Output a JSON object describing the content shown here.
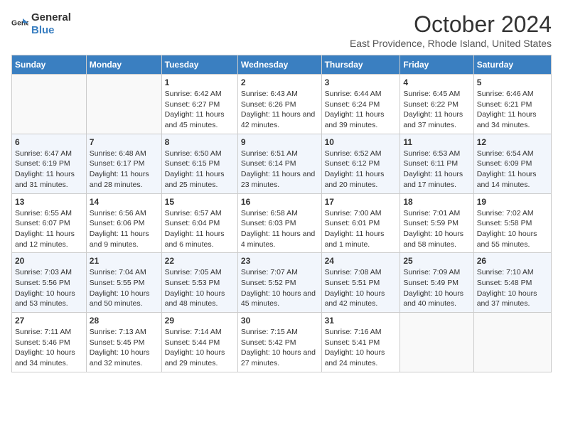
{
  "header": {
    "logo_general": "General",
    "logo_blue": "Blue",
    "title": "October 2024",
    "subtitle": "East Providence, Rhode Island, United States"
  },
  "days_of_week": [
    "Sunday",
    "Monday",
    "Tuesday",
    "Wednesday",
    "Thursday",
    "Friday",
    "Saturday"
  ],
  "weeks": [
    [
      {
        "day": "",
        "info": ""
      },
      {
        "day": "",
        "info": ""
      },
      {
        "day": "1",
        "info": "Sunrise: 6:42 AM\nSunset: 6:27 PM\nDaylight: 11 hours and 45 minutes."
      },
      {
        "day": "2",
        "info": "Sunrise: 6:43 AM\nSunset: 6:26 PM\nDaylight: 11 hours and 42 minutes."
      },
      {
        "day": "3",
        "info": "Sunrise: 6:44 AM\nSunset: 6:24 PM\nDaylight: 11 hours and 39 minutes."
      },
      {
        "day": "4",
        "info": "Sunrise: 6:45 AM\nSunset: 6:22 PM\nDaylight: 11 hours and 37 minutes."
      },
      {
        "day": "5",
        "info": "Sunrise: 6:46 AM\nSunset: 6:21 PM\nDaylight: 11 hours and 34 minutes."
      }
    ],
    [
      {
        "day": "6",
        "info": "Sunrise: 6:47 AM\nSunset: 6:19 PM\nDaylight: 11 hours and 31 minutes."
      },
      {
        "day": "7",
        "info": "Sunrise: 6:48 AM\nSunset: 6:17 PM\nDaylight: 11 hours and 28 minutes."
      },
      {
        "day": "8",
        "info": "Sunrise: 6:50 AM\nSunset: 6:15 PM\nDaylight: 11 hours and 25 minutes."
      },
      {
        "day": "9",
        "info": "Sunrise: 6:51 AM\nSunset: 6:14 PM\nDaylight: 11 hours and 23 minutes."
      },
      {
        "day": "10",
        "info": "Sunrise: 6:52 AM\nSunset: 6:12 PM\nDaylight: 11 hours and 20 minutes."
      },
      {
        "day": "11",
        "info": "Sunrise: 6:53 AM\nSunset: 6:11 PM\nDaylight: 11 hours and 17 minutes."
      },
      {
        "day": "12",
        "info": "Sunrise: 6:54 AM\nSunset: 6:09 PM\nDaylight: 11 hours and 14 minutes."
      }
    ],
    [
      {
        "day": "13",
        "info": "Sunrise: 6:55 AM\nSunset: 6:07 PM\nDaylight: 11 hours and 12 minutes."
      },
      {
        "day": "14",
        "info": "Sunrise: 6:56 AM\nSunset: 6:06 PM\nDaylight: 11 hours and 9 minutes."
      },
      {
        "day": "15",
        "info": "Sunrise: 6:57 AM\nSunset: 6:04 PM\nDaylight: 11 hours and 6 minutes."
      },
      {
        "day": "16",
        "info": "Sunrise: 6:58 AM\nSunset: 6:03 PM\nDaylight: 11 hours and 4 minutes."
      },
      {
        "day": "17",
        "info": "Sunrise: 7:00 AM\nSunset: 6:01 PM\nDaylight: 11 hours and 1 minute."
      },
      {
        "day": "18",
        "info": "Sunrise: 7:01 AM\nSunset: 5:59 PM\nDaylight: 10 hours and 58 minutes."
      },
      {
        "day": "19",
        "info": "Sunrise: 7:02 AM\nSunset: 5:58 PM\nDaylight: 10 hours and 55 minutes."
      }
    ],
    [
      {
        "day": "20",
        "info": "Sunrise: 7:03 AM\nSunset: 5:56 PM\nDaylight: 10 hours and 53 minutes."
      },
      {
        "day": "21",
        "info": "Sunrise: 7:04 AM\nSunset: 5:55 PM\nDaylight: 10 hours and 50 minutes."
      },
      {
        "day": "22",
        "info": "Sunrise: 7:05 AM\nSunset: 5:53 PM\nDaylight: 10 hours and 48 minutes."
      },
      {
        "day": "23",
        "info": "Sunrise: 7:07 AM\nSunset: 5:52 PM\nDaylight: 10 hours and 45 minutes."
      },
      {
        "day": "24",
        "info": "Sunrise: 7:08 AM\nSunset: 5:51 PM\nDaylight: 10 hours and 42 minutes."
      },
      {
        "day": "25",
        "info": "Sunrise: 7:09 AM\nSunset: 5:49 PM\nDaylight: 10 hours and 40 minutes."
      },
      {
        "day": "26",
        "info": "Sunrise: 7:10 AM\nSunset: 5:48 PM\nDaylight: 10 hours and 37 minutes."
      }
    ],
    [
      {
        "day": "27",
        "info": "Sunrise: 7:11 AM\nSunset: 5:46 PM\nDaylight: 10 hours and 34 minutes."
      },
      {
        "day": "28",
        "info": "Sunrise: 7:13 AM\nSunset: 5:45 PM\nDaylight: 10 hours and 32 minutes."
      },
      {
        "day": "29",
        "info": "Sunrise: 7:14 AM\nSunset: 5:44 PM\nDaylight: 10 hours and 29 minutes."
      },
      {
        "day": "30",
        "info": "Sunrise: 7:15 AM\nSunset: 5:42 PM\nDaylight: 10 hours and 27 minutes."
      },
      {
        "day": "31",
        "info": "Sunrise: 7:16 AM\nSunset: 5:41 PM\nDaylight: 10 hours and 24 minutes."
      },
      {
        "day": "",
        "info": ""
      },
      {
        "day": "",
        "info": ""
      }
    ]
  ]
}
